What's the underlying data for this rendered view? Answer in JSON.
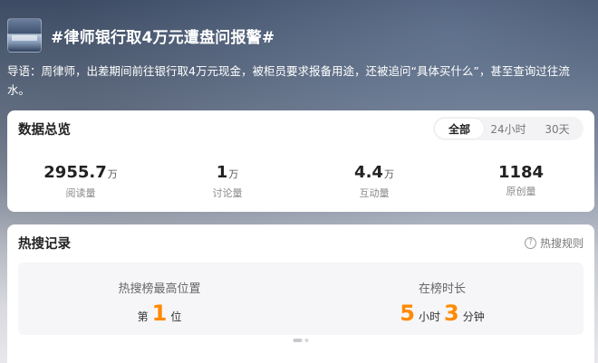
{
  "header": {
    "title": "#律师银行取4万元遭盘问报警#",
    "intro": "导语：周律师，出差期间前往银行取4万元现金，被柜员要求报备用途，还被追问“具体买什么”，甚至查询过往流水。"
  },
  "overview": {
    "title": "数据总览",
    "tabs": [
      {
        "label": "全部",
        "active": true
      },
      {
        "label": "24小时",
        "active": false
      },
      {
        "label": "30天",
        "active": false
      }
    ],
    "stats": [
      {
        "value": "2955.7",
        "unit": "万",
        "label": "阅读量"
      },
      {
        "value": "1",
        "unit": "万",
        "label": "讨论量"
      },
      {
        "value": "4.4",
        "unit": "万",
        "label": "互动量"
      },
      {
        "value": "1184",
        "unit": "",
        "label": "原创量"
      }
    ]
  },
  "hot": {
    "title": "热搜记录",
    "rules_label": "热搜规则",
    "rules_icon": "question-circle-icon",
    "top_position_label": "热搜榜最高位置",
    "top_position_prefix": "第",
    "top_position_value": "1",
    "top_position_suffix": "位",
    "duration_label": "在榜时长",
    "duration_hours": "5",
    "duration_hours_unit": "小时",
    "duration_minutes": "3",
    "duration_minutes_unit": "分钟"
  },
  "colors": {
    "accent": "#ff8a00"
  }
}
